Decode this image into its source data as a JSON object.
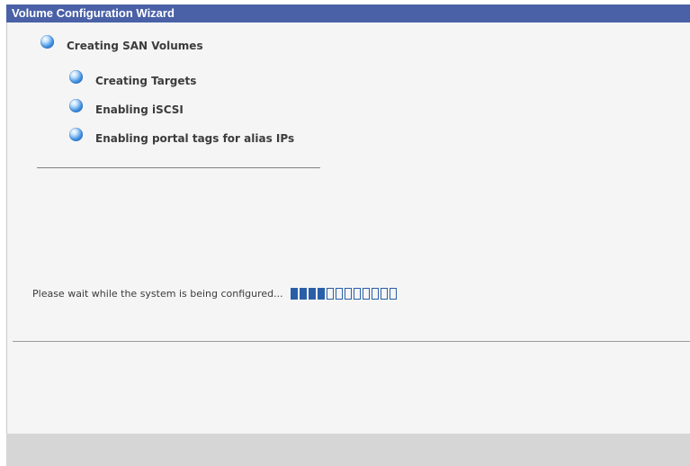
{
  "window": {
    "title": "Volume Configuration Wizard"
  },
  "steps": [
    {
      "label": "Creating SAN Volumes",
      "level": 0,
      "icon": "globe-bullet-icon"
    },
    {
      "label": "Creating Targets",
      "level": 1,
      "icon": "globe-bullet-icon"
    },
    {
      "label": "Enabling iSCSI",
      "level": 1,
      "icon": "globe-bullet-icon"
    },
    {
      "label": "Enabling portal tags for alias IPs",
      "level": 1,
      "icon": "globe-bullet-icon"
    }
  ],
  "status": {
    "message": "Please wait while the system is being configured...",
    "progress_segments_total": 12,
    "progress_segments_filled": 4
  },
  "colors": {
    "titlebar": "#4a61a8",
    "progress": "#2a5fa8",
    "panel": "#f5f5f5",
    "footer": "#d6d6d6"
  }
}
